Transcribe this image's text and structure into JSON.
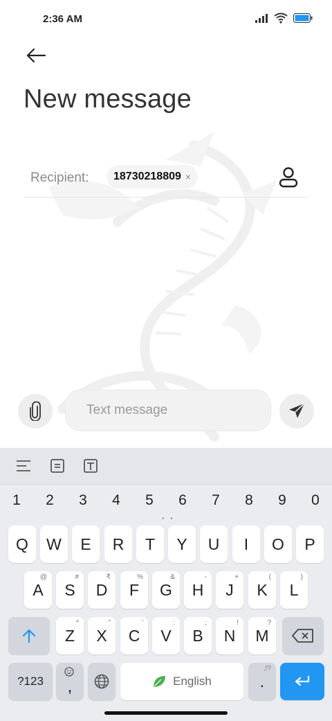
{
  "status_bar": {
    "time": "2:36 AM",
    "icons": [
      "signal-icon",
      "wifi-icon",
      "battery-icon"
    ]
  },
  "header": {
    "back_icon": "back-arrow-icon",
    "title": "New message"
  },
  "recipient": {
    "label": "Recipient:",
    "chip_number": "18730218809",
    "chip_remove": "×",
    "contact_icon": "contact-person-icon"
  },
  "composer": {
    "attach_icon": "paperclip-icon",
    "placeholder": "Text message",
    "value": "",
    "send_icon": "send-icon"
  },
  "keyboard": {
    "toolbar_icons": [
      "menu-lines-icon",
      "clipboard-icon",
      "text-box-icon"
    ],
    "number_row": [
      "1",
      "2",
      "3",
      "4",
      "5",
      "6",
      "7",
      "8",
      "9",
      "0"
    ],
    "row1": [
      {
        "label": "Q",
        "sup": ""
      },
      {
        "label": "W",
        "sup": ""
      },
      {
        "label": "E",
        "sup": ""
      },
      {
        "label": "R",
        "sup": ""
      },
      {
        "label": "T",
        "sup": ""
      },
      {
        "label": "Y",
        "sup": ""
      },
      {
        "label": "U",
        "sup": ""
      },
      {
        "label": "I",
        "sup": ""
      },
      {
        "label": "O",
        "sup": ""
      },
      {
        "label": "P",
        "sup": ""
      }
    ],
    "row2": [
      {
        "label": "A",
        "sup": "@"
      },
      {
        "label": "S",
        "sup": "#"
      },
      {
        "label": "D",
        "sup": "₹"
      },
      {
        "label": "F",
        "sup": "%"
      },
      {
        "label": "G",
        "sup": "&"
      },
      {
        "label": "H",
        "sup": "-"
      },
      {
        "label": "J",
        "sup": "+"
      },
      {
        "label": "K",
        "sup": "("
      },
      {
        "label": "L",
        "sup": ")"
      }
    ],
    "row3": [
      {
        "label": "Z",
        "sup": "*"
      },
      {
        "label": "X",
        "sup": "\""
      },
      {
        "label": "C",
        "sup": "'"
      },
      {
        "label": "V",
        "sup": ":"
      },
      {
        "label": "B",
        "sup": ";"
      },
      {
        "label": "N",
        "sup": "!"
      },
      {
        "label": "M",
        "sup": "?"
      }
    ],
    "shift_icon": "shift-arrow-icon",
    "backspace_icon": "backspace-icon",
    "symbols_label": "?123",
    "comma_label": ",",
    "emoji_icon": "emoji-icon",
    "globe_icon": "globe-icon",
    "space_label": "English",
    "leaf_icon": "leaf-icon",
    "period_label": ".",
    "period_sup": ",!?",
    "enter_icon": "enter-arrow-icon"
  },
  "colors": {
    "accent": "#2196f3",
    "key_bg": "#ffffff",
    "special_key_bg": "#d3d7dd",
    "keyboard_bg": "#eaecef",
    "leaf": "#4caf50"
  }
}
